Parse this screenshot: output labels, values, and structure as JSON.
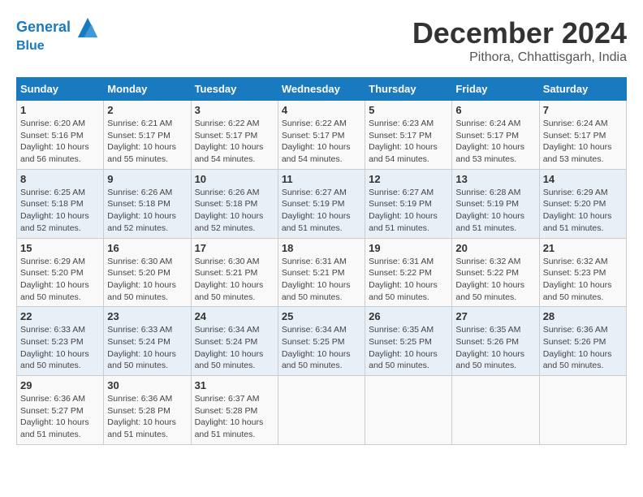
{
  "header": {
    "logo_line1": "General",
    "logo_line2": "Blue",
    "month": "December 2024",
    "location": "Pithora, Chhattisgarh, India"
  },
  "weekdays": [
    "Sunday",
    "Monday",
    "Tuesday",
    "Wednesday",
    "Thursday",
    "Friday",
    "Saturday"
  ],
  "weeks": [
    [
      {
        "day": "1",
        "sunrise": "6:20 AM",
        "sunset": "5:16 PM",
        "daylight": "10 hours and 56 minutes."
      },
      {
        "day": "2",
        "sunrise": "6:21 AM",
        "sunset": "5:17 PM",
        "daylight": "10 hours and 55 minutes."
      },
      {
        "day": "3",
        "sunrise": "6:22 AM",
        "sunset": "5:17 PM",
        "daylight": "10 hours and 54 minutes."
      },
      {
        "day": "4",
        "sunrise": "6:22 AM",
        "sunset": "5:17 PM",
        "daylight": "10 hours and 54 minutes."
      },
      {
        "day": "5",
        "sunrise": "6:23 AM",
        "sunset": "5:17 PM",
        "daylight": "10 hours and 54 minutes."
      },
      {
        "day": "6",
        "sunrise": "6:24 AM",
        "sunset": "5:17 PM",
        "daylight": "10 hours and 53 minutes."
      },
      {
        "day": "7",
        "sunrise": "6:24 AM",
        "sunset": "5:17 PM",
        "daylight": "10 hours and 53 minutes."
      }
    ],
    [
      {
        "day": "8",
        "sunrise": "6:25 AM",
        "sunset": "5:18 PM",
        "daylight": "10 hours and 52 minutes."
      },
      {
        "day": "9",
        "sunrise": "6:26 AM",
        "sunset": "5:18 PM",
        "daylight": "10 hours and 52 minutes."
      },
      {
        "day": "10",
        "sunrise": "6:26 AM",
        "sunset": "5:18 PM",
        "daylight": "10 hours and 52 minutes."
      },
      {
        "day": "11",
        "sunrise": "6:27 AM",
        "sunset": "5:19 PM",
        "daylight": "10 hours and 51 minutes."
      },
      {
        "day": "12",
        "sunrise": "6:27 AM",
        "sunset": "5:19 PM",
        "daylight": "10 hours and 51 minutes."
      },
      {
        "day": "13",
        "sunrise": "6:28 AM",
        "sunset": "5:19 PM",
        "daylight": "10 hours and 51 minutes."
      },
      {
        "day": "14",
        "sunrise": "6:29 AM",
        "sunset": "5:20 PM",
        "daylight": "10 hours and 51 minutes."
      }
    ],
    [
      {
        "day": "15",
        "sunrise": "6:29 AM",
        "sunset": "5:20 PM",
        "daylight": "10 hours and 50 minutes."
      },
      {
        "day": "16",
        "sunrise": "6:30 AM",
        "sunset": "5:20 PM",
        "daylight": "10 hours and 50 minutes."
      },
      {
        "day": "17",
        "sunrise": "6:30 AM",
        "sunset": "5:21 PM",
        "daylight": "10 hours and 50 minutes."
      },
      {
        "day": "18",
        "sunrise": "6:31 AM",
        "sunset": "5:21 PM",
        "daylight": "10 hours and 50 minutes."
      },
      {
        "day": "19",
        "sunrise": "6:31 AM",
        "sunset": "5:22 PM",
        "daylight": "10 hours and 50 minutes."
      },
      {
        "day": "20",
        "sunrise": "6:32 AM",
        "sunset": "5:22 PM",
        "daylight": "10 hours and 50 minutes."
      },
      {
        "day": "21",
        "sunrise": "6:32 AM",
        "sunset": "5:23 PM",
        "daylight": "10 hours and 50 minutes."
      }
    ],
    [
      {
        "day": "22",
        "sunrise": "6:33 AM",
        "sunset": "5:23 PM",
        "daylight": "10 hours and 50 minutes."
      },
      {
        "day": "23",
        "sunrise": "6:33 AM",
        "sunset": "5:24 PM",
        "daylight": "10 hours and 50 minutes."
      },
      {
        "day": "24",
        "sunrise": "6:34 AM",
        "sunset": "5:24 PM",
        "daylight": "10 hours and 50 minutes."
      },
      {
        "day": "25",
        "sunrise": "6:34 AM",
        "sunset": "5:25 PM",
        "daylight": "10 hours and 50 minutes."
      },
      {
        "day": "26",
        "sunrise": "6:35 AM",
        "sunset": "5:25 PM",
        "daylight": "10 hours and 50 minutes."
      },
      {
        "day": "27",
        "sunrise": "6:35 AM",
        "sunset": "5:26 PM",
        "daylight": "10 hours and 50 minutes."
      },
      {
        "day": "28",
        "sunrise": "6:36 AM",
        "sunset": "5:26 PM",
        "daylight": "10 hours and 50 minutes."
      }
    ],
    [
      {
        "day": "29",
        "sunrise": "6:36 AM",
        "sunset": "5:27 PM",
        "daylight": "10 hours and 51 minutes."
      },
      {
        "day": "30",
        "sunrise": "6:36 AM",
        "sunset": "5:28 PM",
        "daylight": "10 hours and 51 minutes."
      },
      {
        "day": "31",
        "sunrise": "6:37 AM",
        "sunset": "5:28 PM",
        "daylight": "10 hours and 51 minutes."
      },
      null,
      null,
      null,
      null
    ]
  ]
}
